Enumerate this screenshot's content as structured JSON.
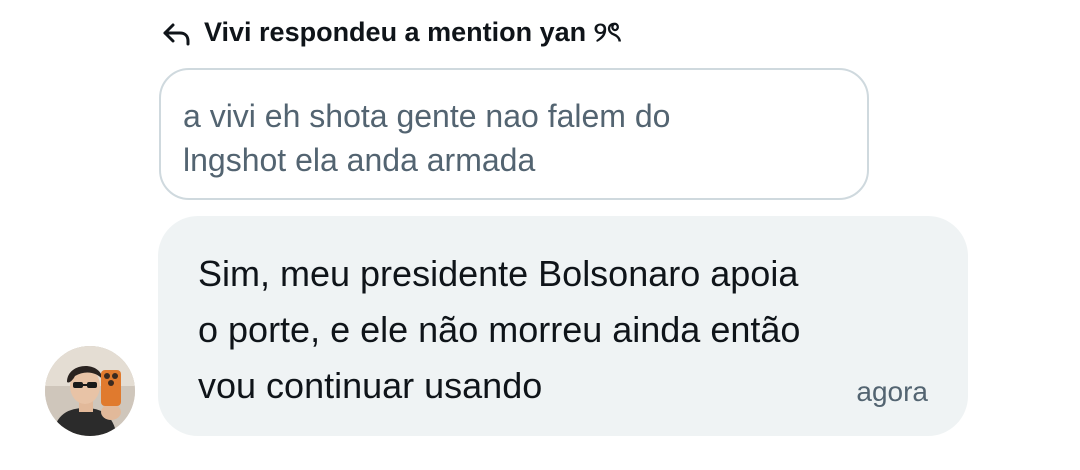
{
  "reply_header": {
    "icon": "reply-arrow-icon",
    "text": "Vivi respondeu a mention yan ୨ৎ"
  },
  "quoted_message": {
    "text": "a vivi eh shota gente nao falem do\nlngshot ela anda armada"
  },
  "message": {
    "text": "Sim, meu presidente Bolsonaro apoia\no porte, e ele não morreu ainda então\nvou continuar usando",
    "timestamp": "agora",
    "bubble_color": "#eff3f4"
  },
  "avatar": {
    "icon": "user-avatar"
  },
  "colors": {
    "primary_text": "#0f1419",
    "secondary_text": "#536471",
    "border": "#cfd9de"
  }
}
